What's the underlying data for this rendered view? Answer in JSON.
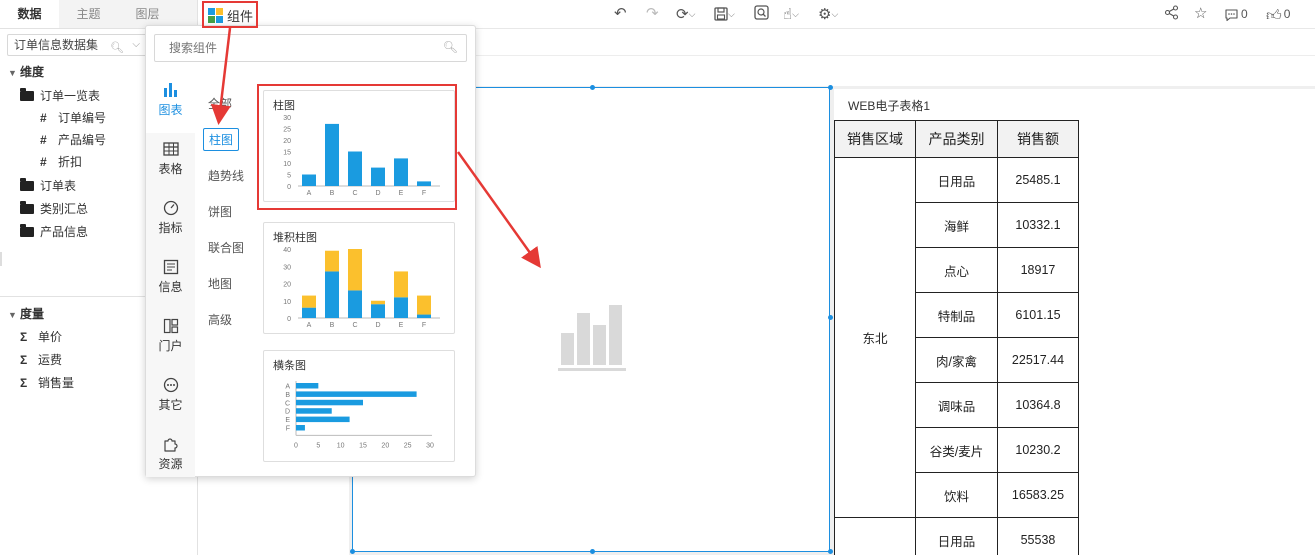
{
  "left_panel": {
    "tabs": [
      "数据",
      "主题",
      "图层"
    ],
    "dataset": "订单信息数据集",
    "dimension": {
      "title": "维度",
      "items": [
        {
          "label": "订单一览表",
          "kind": "open-folder"
        },
        {
          "label": "订单编号",
          "kind": "field"
        },
        {
          "label": "产品编号",
          "kind": "field"
        },
        {
          "label": "折扣",
          "kind": "field"
        },
        {
          "label": "订单表",
          "kind": "folder"
        },
        {
          "label": "类别汇总",
          "kind": "folder"
        },
        {
          "label": "产品信息",
          "kind": "folder"
        }
      ]
    },
    "measure": {
      "title": "度量",
      "items": [
        {
          "label": "单价",
          "kind": "sum"
        },
        {
          "label": "运费",
          "kind": "sum"
        },
        {
          "label": "销售量",
          "kind": "sum"
        }
      ]
    }
  },
  "toolbar": {
    "component_label": "组件",
    "comment_count": "0",
    "like_count": "0"
  },
  "popup": {
    "search_placeholder": "搜索组件",
    "categories": [
      "图表",
      "表格",
      "指标",
      "信息",
      "门户",
      "其它",
      "资源"
    ],
    "subcategories": [
      "全部",
      "柱图",
      "趋势线",
      "饼图",
      "联合图",
      "地图",
      "高级"
    ],
    "cards": [
      {
        "title": "柱图",
        "chart_data": {
          "type": "bar",
          "categories": [
            "A",
            "B",
            "C",
            "D",
            "E",
            "F"
          ],
          "values": [
            5,
            27,
            15,
            8,
            12,
            2
          ],
          "yticks": [
            "0",
            "5",
            "10",
            "15",
            "20",
            "25",
            "30"
          ],
          "ylim": [
            0,
            30
          ],
          "color": "#1a9be0"
        }
      },
      {
        "title": "堆积柱图",
        "chart_data": {
          "type": "bar",
          "stacked": true,
          "categories": [
            "A",
            "B",
            "C",
            "D",
            "E",
            "F"
          ],
          "series": [
            {
              "values": [
                6,
                27,
                16,
                8,
                12,
                2
              ],
              "color": "#1a9be0"
            },
            {
              "values": [
                7,
                12,
                24,
                2,
                15,
                11
              ],
              "color": "#fbc02d"
            }
          ],
          "yticks": [
            "0",
            "10",
            "20",
            "30",
            "40"
          ],
          "ylim": [
            0,
            40
          ]
        }
      },
      {
        "title": "横条图",
        "chart_data": {
          "type": "bar",
          "orientation": "horizontal",
          "categories": [
            "A",
            "B",
            "C",
            "D",
            "E",
            "F"
          ],
          "values": [
            5,
            27,
            15,
            8,
            12,
            2
          ],
          "xticks": [
            "0",
            "5",
            "10",
            "15",
            "20",
            "25",
            "30"
          ],
          "xlim": [
            0,
            30
          ],
          "color": "#1a9be0"
        }
      }
    ]
  },
  "table_widget": {
    "title": "WEB电子表格1",
    "headers": [
      "销售区域",
      "产品类别",
      "销售额"
    ],
    "region": "东北",
    "rows": [
      [
        "日用品",
        "25485.1"
      ],
      [
        "海鲜",
        "10332.1"
      ],
      [
        "点心",
        "18917"
      ],
      [
        "特制品",
        "6101.15"
      ],
      [
        "肉/家禽",
        "22517.44"
      ],
      [
        "调味品",
        "10364.8"
      ],
      [
        "谷类/麦片",
        "10230.2"
      ],
      [
        "饮料",
        "16583.25"
      ],
      [
        "日用品",
        "55538"
      ]
    ]
  },
  "colors": {
    "accent": "#1c8fe0",
    "annotation": "#e53935",
    "bar_blue": "#1a9be0",
    "bar_yellow": "#fbc02d"
  }
}
